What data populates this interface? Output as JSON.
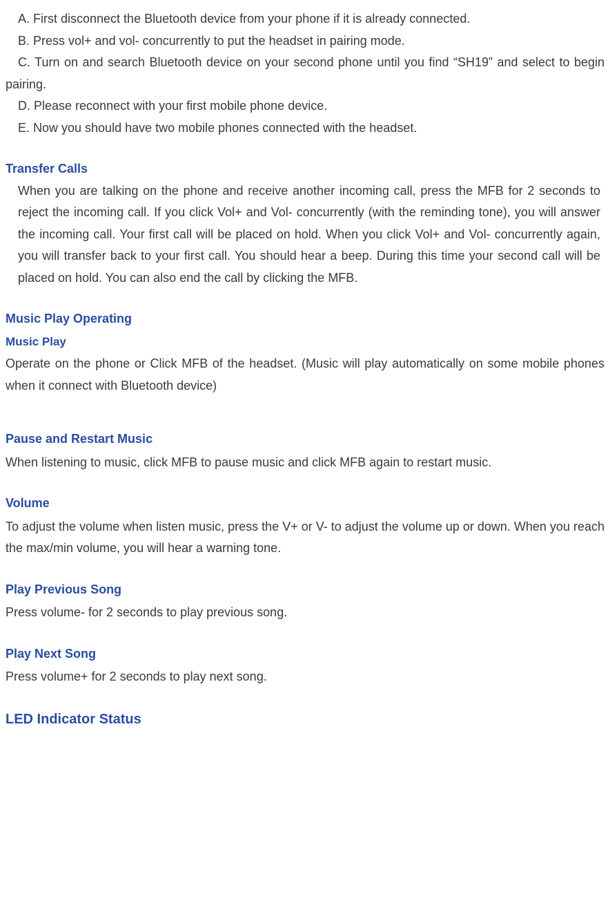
{
  "steps": {
    "a": "A. First disconnect the Bluetooth device from your phone if it is already connected.",
    "b": "B. Press vol+ and vol- concurrently to put the headset in pairing mode.",
    "c": "C. Turn on and search Bluetooth device on your second phone until you find “SH19” and select to begin pairing.",
    "d": "D. Please reconnect with your first mobile phone device.",
    "e": "E. Now you should have two mobile phones connected with the headset."
  },
  "sections": {
    "transfer_calls": {
      "heading": "Transfer Calls",
      "body": "When you are talking on the phone and receive another incoming call, press the MFB for 2 seconds to reject the incoming call. If you click Vol+ and Vol- concurrently (with the reminding tone), you will answer the incoming call. Your first call will be placed on hold. When you click Vol+ and Vol- concurrently again, you will transfer back to your first call. You should hear a beep. During this time your second call will be placed on hold. You can also end the call by clicking the MFB."
    },
    "music_play_operating": {
      "heading": "Music Play Operating",
      "sub": "Music Play",
      "body": "Operate on the phone or Click MFB of the headset. (Music will play automatically on some mobile phones when it connect with Bluetooth device)"
    },
    "pause_restart": {
      "heading": "Pause and Restart Music",
      "body": "When listening to music, click MFB to pause music and click MFB again to restart music."
    },
    "volume": {
      "heading": "Volume",
      "body": "To adjust the volume when listen music, press the V+ or V- to adjust the volume up or down. When you reach the max/min volume, you will hear a warning tone."
    },
    "prev_song": {
      "heading": "Play Previous Song",
      "body": "Press volume- for 2 seconds to play previous song."
    },
    "next_song": {
      "heading": "Play Next Song",
      "body": "Press volume+ for 2 seconds to play next song."
    },
    "led": {
      "heading": "LED Indicator Status"
    }
  }
}
